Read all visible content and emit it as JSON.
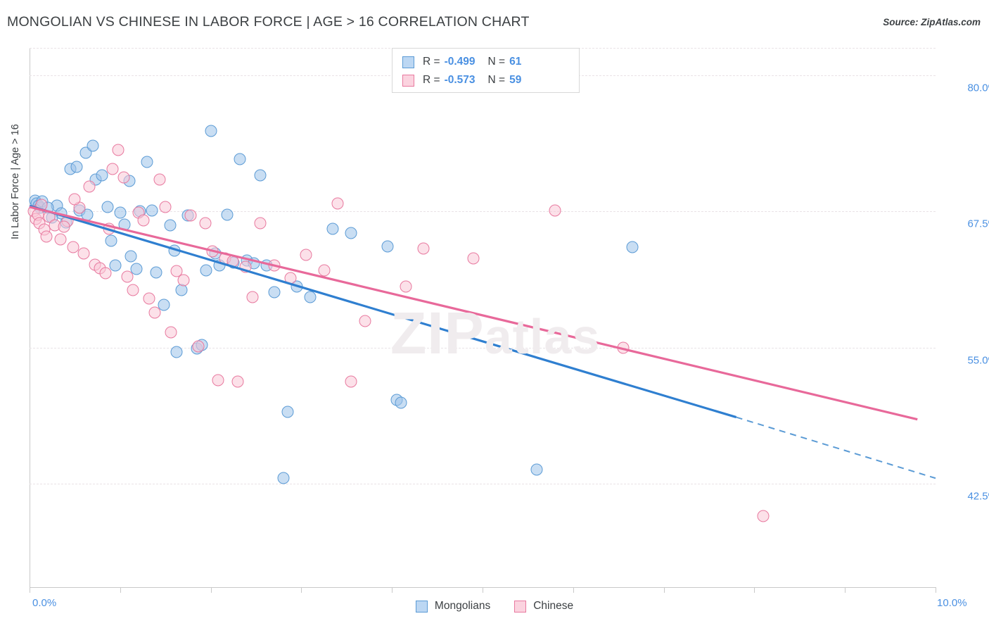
{
  "header": {
    "title": "MONGOLIAN VS CHINESE IN LABOR FORCE | AGE > 16 CORRELATION CHART",
    "source": "Source: ZipAtlas.com"
  },
  "watermark": {
    "big": "ZIP",
    "small": "atlas"
  },
  "legend": {
    "rows": [
      {
        "r_label": "R =",
        "r_value": "-0.499",
        "n_label": "N =",
        "n_value": "61",
        "series": "Mongolians"
      },
      {
        "r_label": "R =",
        "r_value": "-0.573",
        "n_label": "N =",
        "n_value": "59",
        "series": "Chinese"
      }
    ]
  },
  "bottom_legend": [
    {
      "label": "Mongolians",
      "color": "#bcd7f3"
    },
    {
      "label": "Chinese",
      "color": "#fbd3df"
    }
  ],
  "chart_data": {
    "type": "scatter",
    "title": "MONGOLIAN VS CHINESE IN LABOR FORCE | AGE > 16 CORRELATION CHART",
    "xlabel": "",
    "ylabel": "In Labor Force | Age > 16",
    "xlim": [
      0.0,
      10.0
    ],
    "ylim": [
      33.0,
      82.5
    ],
    "x_ticks": [
      "0.0%",
      "10.0%"
    ],
    "x_tick_values": [
      0.0,
      10.0
    ],
    "y_ticks": [
      "80.0%",
      "67.5%",
      "55.0%",
      "42.5%"
    ],
    "y_tick_values": [
      80.0,
      67.5,
      55.0,
      42.5
    ],
    "grid": true,
    "legend_position": "top-center",
    "accent_colors": {
      "mongolian": "#5b9bd5",
      "chinese": "#e8799f",
      "tick": "#4a90e2"
    },
    "series": [
      {
        "name": "Mongolians",
        "color": "#9dc3e9",
        "R": -0.499,
        "N": 61,
        "trendline": {
          "x0": 0.0,
          "y0": 68.0,
          "x1": 7.8,
          "y1": 48.6,
          "dashed_to": {
            "x": 10.0,
            "y": 43.0
          }
        },
        "points": [
          [
            0.06,
            68.5
          ],
          [
            0.08,
            68.2
          ],
          [
            0.1,
            68.0
          ],
          [
            0.12,
            67.8
          ],
          [
            0.14,
            68.4
          ],
          [
            0.3,
            68.0
          ],
          [
            0.45,
            71.4
          ],
          [
            0.52,
            71.6
          ],
          [
            0.62,
            72.9
          ],
          [
            0.7,
            73.5
          ],
          [
            0.73,
            70.4
          ],
          [
            0.8,
            70.8
          ],
          [
            0.86,
            67.9
          ],
          [
            0.9,
            64.8
          ],
          [
            0.95,
            62.5
          ],
          [
            1.0,
            67.4
          ],
          [
            1.05,
            66.3
          ],
          [
            1.1,
            70.3
          ],
          [
            1.18,
            62.2
          ],
          [
            1.22,
            67.5
          ],
          [
            1.3,
            72.0
          ],
          [
            1.35,
            67.6
          ],
          [
            1.4,
            61.9
          ],
          [
            1.48,
            58.9
          ],
          [
            1.55,
            66.2
          ],
          [
            1.6,
            63.9
          ],
          [
            1.62,
            54.6
          ],
          [
            1.75,
            67.1
          ],
          [
            1.85,
            54.9
          ],
          [
            1.9,
            55.2
          ],
          [
            1.95,
            62.1
          ],
          [
            2.0,
            74.9
          ],
          [
            2.05,
            63.6
          ],
          [
            2.1,
            62.5
          ],
          [
            2.18,
            67.2
          ],
          [
            2.25,
            62.8
          ],
          [
            2.32,
            72.3
          ],
          [
            2.4,
            63.0
          ],
          [
            2.48,
            62.7
          ],
          [
            2.55,
            70.8
          ],
          [
            2.62,
            62.5
          ],
          [
            2.7,
            60.1
          ],
          [
            2.8,
            43.0
          ],
          [
            2.85,
            49.1
          ],
          [
            2.95,
            60.6
          ],
          [
            3.1,
            59.6
          ],
          [
            3.35,
            65.9
          ],
          [
            3.55,
            65.5
          ],
          [
            3.95,
            64.3
          ],
          [
            4.05,
            50.2
          ],
          [
            4.1,
            49.9
          ],
          [
            5.6,
            43.8
          ],
          [
            6.65,
            64.2
          ],
          [
            0.55,
            67.6
          ],
          [
            0.64,
            67.2
          ],
          [
            0.4,
            66.5
          ],
          [
            0.35,
            67.3
          ],
          [
            0.2,
            67.8
          ],
          [
            0.25,
            66.9
          ],
          [
            1.12,
            63.4
          ],
          [
            1.68,
            60.3
          ]
        ]
      },
      {
        "name": "Chinese",
        "color": "#f9c8d7",
        "R": -0.573,
        "N": 59,
        "trendline": {
          "x0": 0.0,
          "y0": 67.9,
          "x1": 9.8,
          "y1": 48.4
        },
        "points": [
          [
            0.05,
            67.5
          ],
          [
            0.07,
            66.8
          ],
          [
            0.09,
            67.2
          ],
          [
            0.11,
            66.4
          ],
          [
            0.16,
            65.8
          ],
          [
            0.22,
            67.0
          ],
          [
            0.28,
            66.2
          ],
          [
            0.34,
            64.9
          ],
          [
            0.42,
            66.6
          ],
          [
            0.48,
            64.2
          ],
          [
            0.55,
            67.8
          ],
          [
            0.6,
            63.6
          ],
          [
            0.66,
            69.8
          ],
          [
            0.72,
            62.6
          ],
          [
            0.78,
            62.3
          ],
          [
            0.84,
            61.8
          ],
          [
            0.88,
            65.9
          ],
          [
            0.92,
            71.4
          ],
          [
            0.98,
            73.1
          ],
          [
            1.04,
            70.6
          ],
          [
            1.08,
            61.5
          ],
          [
            1.14,
            60.3
          ],
          [
            1.2,
            67.4
          ],
          [
            1.26,
            66.7
          ],
          [
            1.32,
            59.5
          ],
          [
            1.38,
            58.2
          ],
          [
            1.44,
            70.4
          ],
          [
            1.5,
            67.9
          ],
          [
            1.56,
            56.4
          ],
          [
            1.62,
            62.0
          ],
          [
            1.7,
            61.2
          ],
          [
            1.78,
            67.1
          ],
          [
            1.86,
            55.1
          ],
          [
            1.94,
            66.4
          ],
          [
            2.02,
            63.8
          ],
          [
            2.08,
            52.0
          ],
          [
            2.16,
            63.2
          ],
          [
            2.24,
            62.9
          ],
          [
            2.3,
            51.9
          ],
          [
            2.38,
            62.4
          ],
          [
            2.46,
            59.6
          ],
          [
            2.55,
            66.4
          ],
          [
            2.7,
            62.5
          ],
          [
            2.88,
            61.4
          ],
          [
            3.05,
            63.5
          ],
          [
            3.25,
            62.1
          ],
          [
            3.4,
            68.2
          ],
          [
            3.55,
            51.9
          ],
          [
            3.7,
            57.4
          ],
          [
            4.15,
            60.6
          ],
          [
            4.35,
            64.1
          ],
          [
            4.9,
            63.2
          ],
          [
            5.8,
            67.6
          ],
          [
            6.55,
            55.0
          ],
          [
            8.1,
            39.5
          ],
          [
            0.13,
            68.1
          ],
          [
            0.19,
            65.2
          ],
          [
            0.38,
            66.1
          ],
          [
            0.5,
            68.6
          ]
        ]
      }
    ]
  }
}
